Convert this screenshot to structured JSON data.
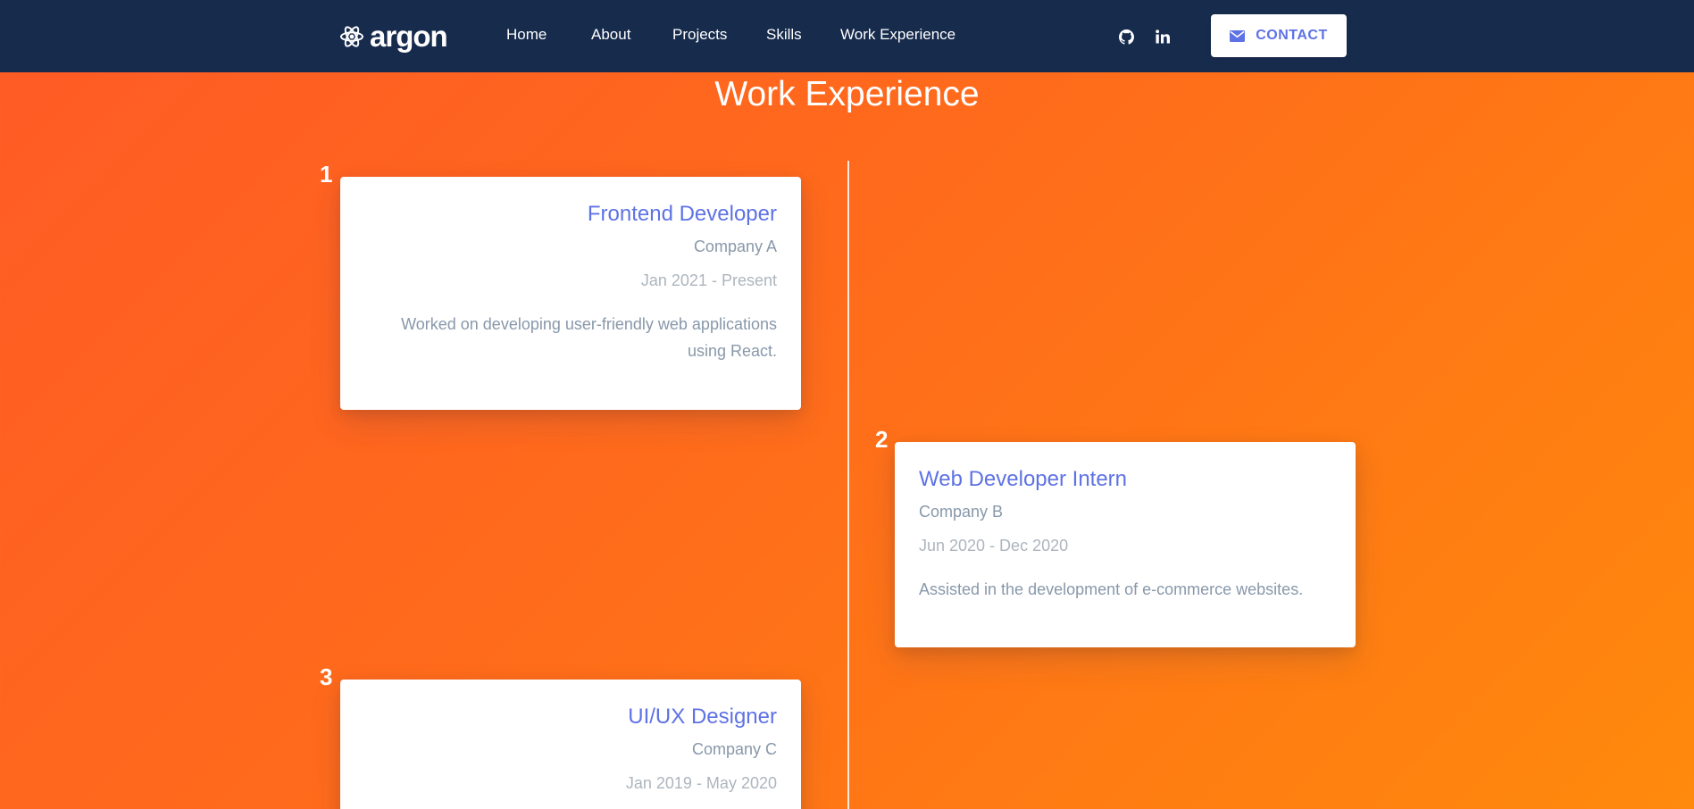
{
  "nav": {
    "brand": "argon",
    "links": [
      "Home",
      "About",
      "Projects",
      "Skills",
      "Work Experience"
    ],
    "social": [
      "github-icon",
      "linkedin-icon"
    ],
    "contact_label": "CONTACT"
  },
  "section": {
    "title": "Work Experience"
  },
  "experiences": [
    {
      "number": "1",
      "title": "Frontend Developer",
      "company": "Company A",
      "dates": "Jan 2021 - Present",
      "description": "Worked on developing user-friendly web applications using React."
    },
    {
      "number": "2",
      "title": "Web Developer Intern",
      "company": "Company B",
      "dates": "Jun 2020 - Dec 2020",
      "description": "Assisted in the development of e-commerce websites."
    },
    {
      "number": "3",
      "title": "UI/UX Designer",
      "company": "Company C",
      "dates": "Jan 2019 - May 2020",
      "description": ""
    }
  ],
  "colors": {
    "navbar": "#172b4d",
    "accent": "#5e72e4",
    "gradient_start": "#ff5a26",
    "gradient_end": "#ff8a0c"
  }
}
